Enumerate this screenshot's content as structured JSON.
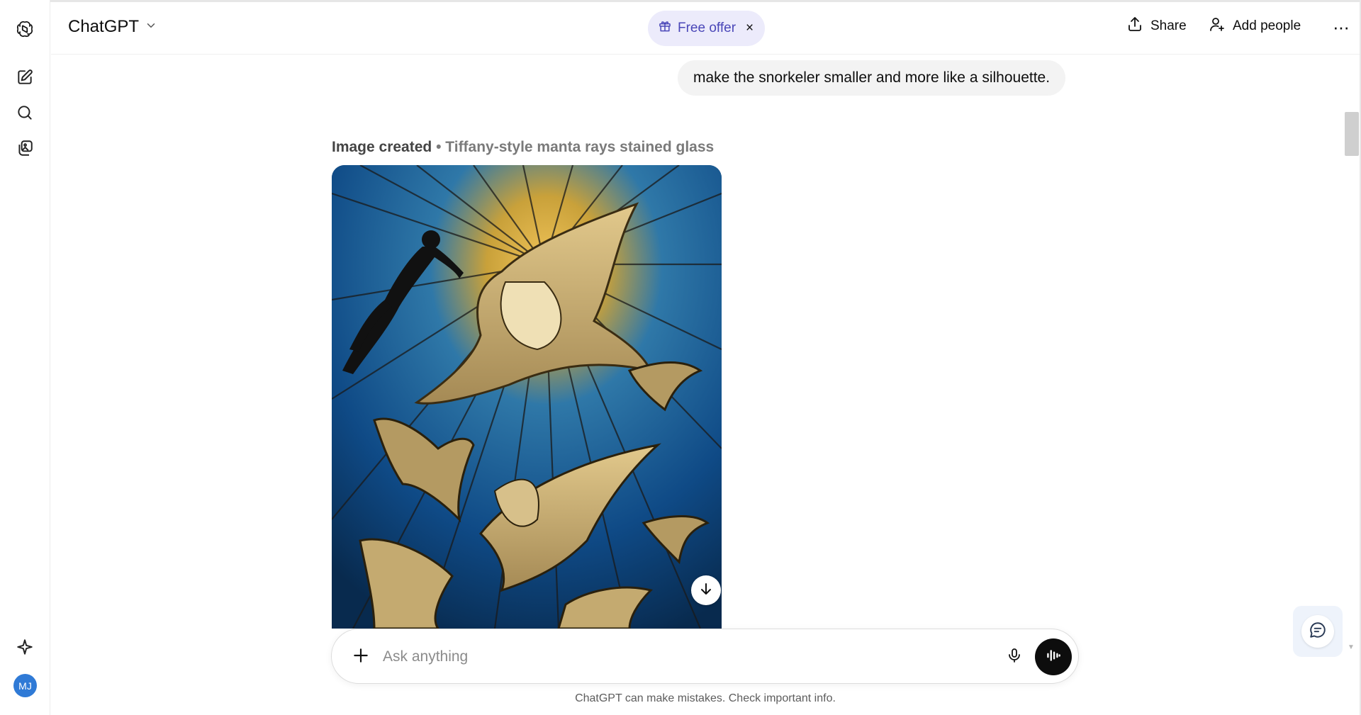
{
  "header": {
    "model_name": "ChatGPT",
    "free_offer_label": "Free offer",
    "free_offer_close": "×",
    "share_label": "Share",
    "add_people_label": "Add people",
    "more_label": "···"
  },
  "sidebar": {
    "items": [
      {
        "icon": "new-chat-icon"
      },
      {
        "icon": "search-icon"
      },
      {
        "icon": "library-icon"
      },
      {
        "icon": "sparkle-icon"
      }
    ],
    "avatar_initials": "MJ",
    "avatar_color": "#2f7ad6"
  },
  "conversation": {
    "user_message": "make the snorkeler smaller and more like a silhouette.",
    "image_caption_strong": "Image created",
    "image_caption_muted": "• Tiffany-style manta rays stained glass"
  },
  "composer": {
    "placeholder": "Ask anything",
    "value": ""
  },
  "footer": {
    "disclaimer": "ChatGPT can make mistakes. Check important info."
  },
  "colors": {
    "free_offer_bg": "#ecebfb",
    "free_offer_text": "#4a47b8",
    "user_bubble_bg": "#f3f3f3",
    "voice_button_bg": "#0d0d0d"
  }
}
